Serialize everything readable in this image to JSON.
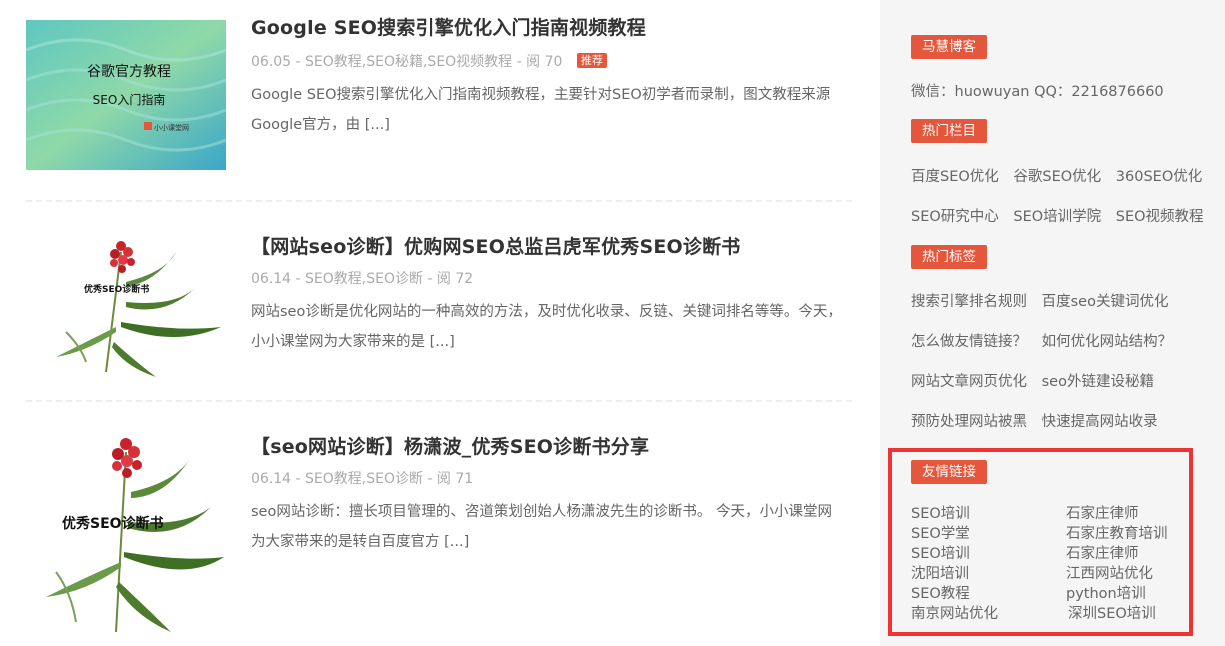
{
  "articles": [
    {
      "title": "Google SEO搜索引擎优化入门指南视频教程",
      "meta": "06.05 - SEO教程,SEO秘籍,SEO视频教程 - 阅 70",
      "badge": "推荐",
      "excerpt": "Google SEO搜索引擎优化入门指南视频教程，主要针对SEO初学者而录制，图文教程来源Google官方，由",
      "more": "[...]",
      "thumb_lines": [
        "谷歌官方教程",
        "SEO入门指南",
        "小小课堂网"
      ]
    },
    {
      "title": "【网站seo诊断】优购网SEO总监吕虎军优秀SEO诊断书",
      "meta": "06.14 - SEO教程,SEO诊断 - 阅 72",
      "excerpt": "网站seo诊断是优化网站的一种高效的方法，及时优化收录、反链、关键词排名等等。今天，小小课堂网为大家带来的是",
      "more": "[...]",
      "thumb_lines": [
        "优秀SEO诊断书"
      ]
    },
    {
      "title": "【seo网站诊断】杨潇波_优秀SEO诊断书分享",
      "meta": "06.14 - SEO教程,SEO诊断 - 阅 71",
      "excerpt": "seo网站诊断：擅长项目管理的、咨道策划创始人杨潇波先生的诊断书。 今天，小小课堂网为大家带来的是转自百度官方",
      "more": "[...]",
      "thumb_lines": [
        "优秀SEO诊断书"
      ]
    }
  ],
  "sidebar": {
    "blog_title": "马慧博客",
    "contact": "微信：huowuyan     QQ：2216876660",
    "hot_columns_title": "热门栏目",
    "hot_columns": [
      "百度SEO优化",
      "谷歌SEO优化",
      "360SEO优化",
      "SEO研究中心",
      "SEO培训学院",
      "SEO视频教程"
    ],
    "hot_tags_title": "热门标签",
    "hot_tags": [
      "搜索引擎排名规则",
      "百度seo关键词优化",
      "怎么做友情链接？",
      "如何优化网站结构？",
      "网站文章网页优化",
      "seo外链建设秘籍",
      "预防处理网站被黑",
      "快速提高网站收录"
    ],
    "friend_links_title": "友情链接",
    "friend_links_left": [
      "SEO培训",
      "SEO学堂",
      "SEO培训",
      "沈阳培训",
      "SEO教程",
      "南京网站优化"
    ],
    "friend_links_right": [
      "石家庄律师",
      "石家庄教育培训",
      "石家庄律师",
      "江西网站优化",
      "python培训",
      "深圳SEO培训"
    ]
  },
  "colors": {
    "accent": "#e4573d",
    "highlight_box": "#ee3333"
  }
}
